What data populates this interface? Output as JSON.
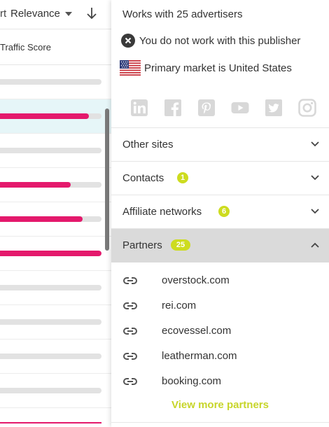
{
  "left": {
    "sort_prefix": "rt",
    "sort_value": "Relevance",
    "column_header": "Traffic Score",
    "rows": [
      {
        "score": null,
        "highlighted": false
      },
      {
        "score": 0.88,
        "highlighted": true
      },
      {
        "score": null,
        "highlighted": false
      },
      {
        "score": 0.71,
        "highlighted": false
      },
      {
        "score": 0.82,
        "highlighted": false
      },
      {
        "score": 1.0,
        "highlighted": false
      },
      {
        "score": null,
        "highlighted": false
      },
      {
        "score": null,
        "highlighted": false
      },
      {
        "score": null,
        "highlighted": false
      },
      {
        "score": null,
        "highlighted": false
      }
    ]
  },
  "details": {
    "advertisers_text": "Works with 25 advertisers",
    "publisher_status": "You do not work with this publisher",
    "primary_market": "Primary market is United States",
    "social": [
      "linkedin-icon",
      "facebook-icon",
      "pinterest-icon",
      "youtube-icon",
      "twitter-icon",
      "instagram-icon"
    ]
  },
  "sections": {
    "other_sites": {
      "label": "Other sites"
    },
    "contacts": {
      "label": "Contacts",
      "count": "1"
    },
    "affiliate": {
      "label": "Affiliate networks",
      "count": "6"
    },
    "partners": {
      "label": "Partners",
      "count": "25"
    }
  },
  "partners": [
    "overstock.com",
    "rei.com",
    "ecovessel.com",
    "leatherman.com",
    "booking.com"
  ],
  "view_more": "View more partners",
  "colors": {
    "accent_pink": "#e4196c",
    "accent_lime": "#cddc1f",
    "link_lime": "#c7d52a"
  }
}
